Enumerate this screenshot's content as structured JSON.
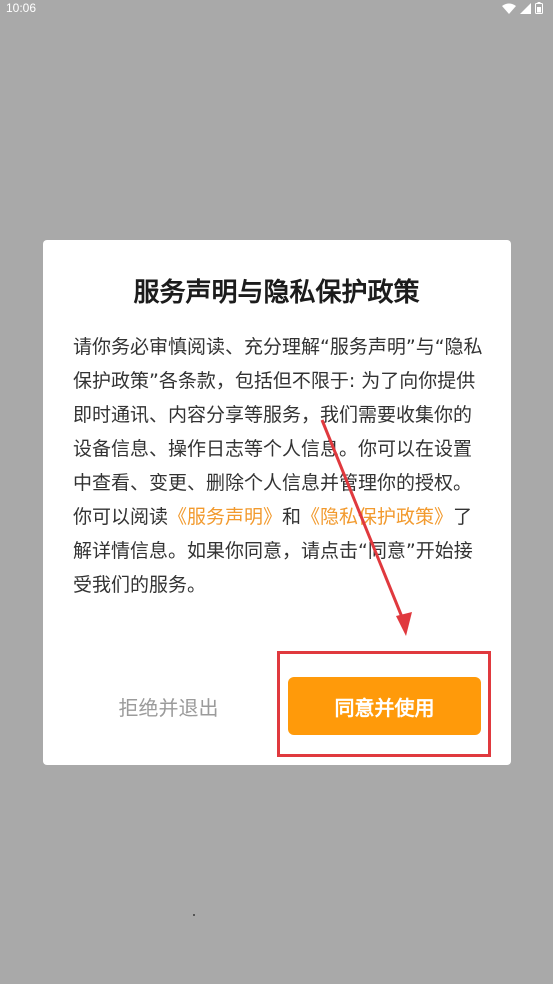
{
  "status_bar": {
    "time": "10:06",
    "icons": [
      "wifi-icon",
      "signal-icon",
      "battery-icon"
    ]
  },
  "dialog": {
    "title": "服务声明与隐私保护政策",
    "paragraph1": "请你务必审慎阅读、充分理解“服务声明”与“隐私保护政策”各条款，包括但不限于: 为了向你提供即时通讯、内容分享等服务，我们需要收集你的设备信息、操作日志等个人信息。你可以在设置中查看、变更、删除个人信息并管理你的授权。",
    "p2_prefix": "你可以阅读",
    "service_link": "《服务声明》",
    "p2_and": "和",
    "privacy_link": "《隐私保护政策》",
    "p2_suffix": "了解详情信息。如果你同意，请点击“同意”开始接受我们的服务。",
    "decline_label": "拒绝并退出",
    "agree_label": "同意并使用"
  },
  "colors": {
    "overlay": "#a9a9a9",
    "accent": "#ff9a0a",
    "link": "#f29a2e",
    "annotation": "#e0393e"
  }
}
